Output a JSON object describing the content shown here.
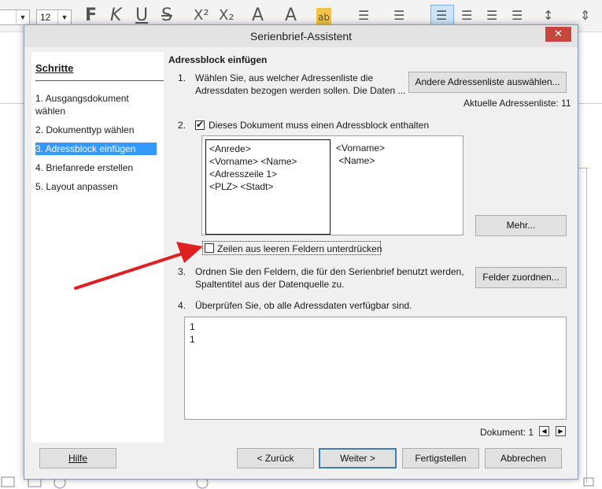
{
  "toolbar": {
    "style_value": "",
    "font_size": "12",
    "glyphs": [
      "F",
      "K",
      "U",
      "S",
      "X²",
      "X₂",
      "A",
      "A",
      "ab"
    ]
  },
  "dialog": {
    "title": "Serienbrief-Assistent",
    "close_label": "✕",
    "steps_heading": "Schritte",
    "steps": [
      "1. Ausgangsdokument wählen",
      "2. Dokumenttyp wählen",
      "3. Adressblock einfügen",
      "4. Briefanrede erstellen",
      "5. Layout anpassen"
    ],
    "active_step": 2,
    "section_title": "Adressblock einfügen",
    "step1": {
      "number": "1.",
      "text_line1": "Wählen Sie, aus welcher Adressenliste die",
      "text_line2": "Adressdaten bezogen werden sollen. Die Daten ...",
      "button": "Andere Adressenliste auswählen...",
      "current_list": "Aktuelle Adressenliste: 11"
    },
    "step2": {
      "number": "2.",
      "checkbox_label": "Dieses Dokument muss einen Adressblock enthalten",
      "checked": true,
      "address_block_1": [
        "<Anrede>",
        "<Vorname> <Name>",
        "<Adresszeile 1>",
        "<PLZ> <Stadt>"
      ],
      "address_block_2": [
        "<Vorname>",
        " <Name>"
      ],
      "more_button": "Mehr...",
      "suppress_label": "Zeilen aus leeren Feldern unterdrücken",
      "suppress_checked": false
    },
    "step3": {
      "number": "3.",
      "text_line1": "Ordnen Sie den Feldern, die für den Serienbrief benutzt werden,",
      "text_line2": "Spaltentitel aus der Datenquelle zu.",
      "button": "Felder zuordnen..."
    },
    "step4": {
      "number": "4.",
      "text": "Überprüfen Sie, ob alle Adressdaten verfügbar sind.",
      "preview_lines": [
        "1",
        "1"
      ]
    },
    "document_label": "Dokument: 1",
    "buttons": {
      "help": "Hilfe",
      "back": "< Zurück",
      "next": "Weiter >",
      "finish": "Fertigstellen",
      "cancel": "Abbrechen"
    }
  },
  "annotation": {
    "arrow_color": "#e02020"
  }
}
